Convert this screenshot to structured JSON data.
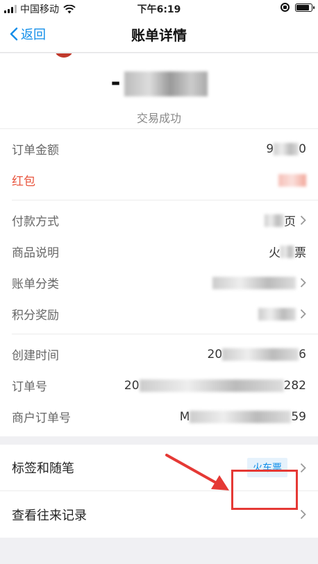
{
  "status_bar": {
    "carrier": "中国移动",
    "time": "下午6:19"
  },
  "nav": {
    "back_label": "返回",
    "title": "账单详情"
  },
  "summary": {
    "amount_prefix": "-",
    "status": "交易成功"
  },
  "group1": [
    {
      "label": "订单金额",
      "value_head": "9",
      "value_tail": "0"
    },
    {
      "label": "红包",
      "value_head": "",
      "value_tail": ""
    }
  ],
  "group2": [
    {
      "label": "付款方式",
      "value_head": "",
      "value_tail": "页"
    },
    {
      "label": "商品说明",
      "value_head": "火",
      "value_tail": "票"
    },
    {
      "label": "账单分类",
      "value_head": "",
      "value_tail": ""
    },
    {
      "label": "积分奖励",
      "value_head": "",
      "value_tail": ""
    }
  ],
  "group3": [
    {
      "label": "创建时间",
      "value_head": "20",
      "value_tail": "6"
    },
    {
      "label": "订单号",
      "value_head": "20",
      "value_tail": "282"
    },
    {
      "label": "商户订单号",
      "value_head": "M",
      "value_tail": "59"
    }
  ],
  "actions": {
    "tags_label": "标签和随笔",
    "tag": "火车票",
    "history_label": "查看往来记录"
  },
  "colors": {
    "accent": "#108ee9",
    "red": "#e8553e",
    "highlight": "#e53935"
  }
}
